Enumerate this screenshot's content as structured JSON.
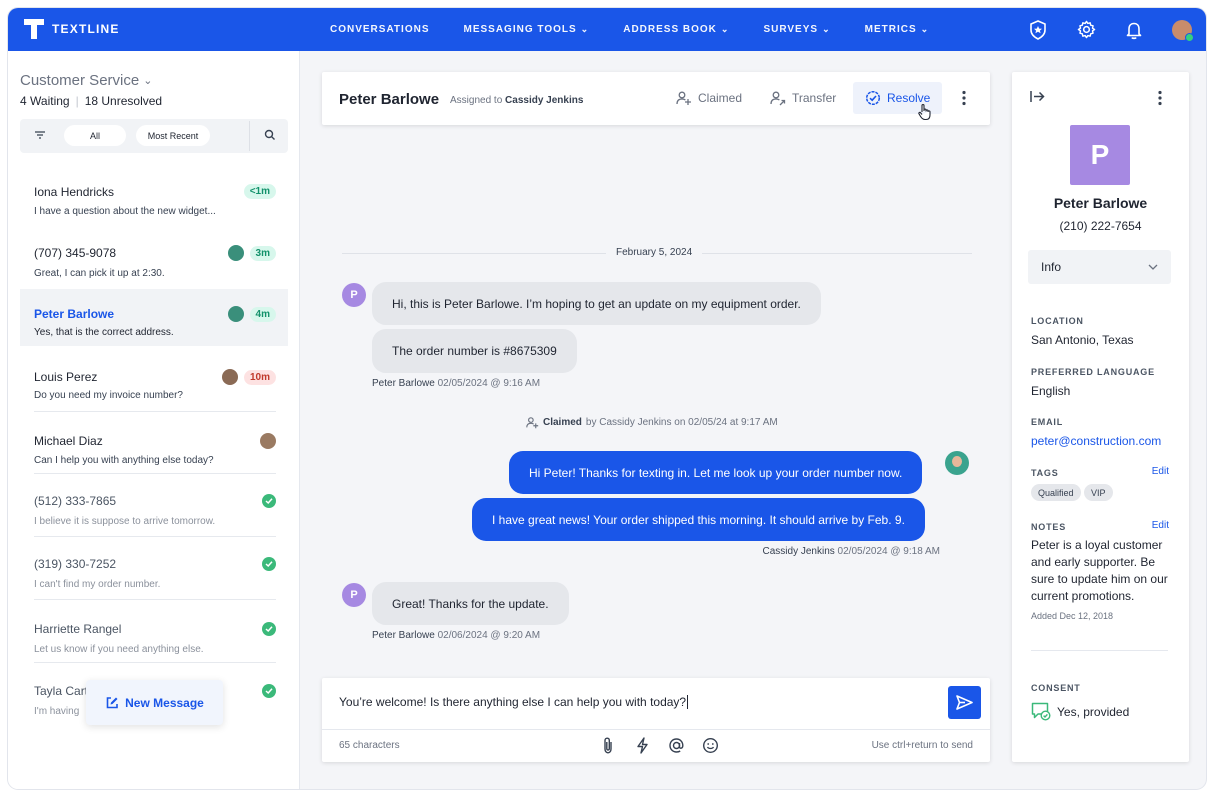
{
  "app": {
    "logo_text": "TEXTLINE",
    "brand_color": "#1a56e8"
  },
  "nav": [
    {
      "label": "CONVERSATIONS",
      "has_menu": false
    },
    {
      "label": "MESSAGING TOOLS",
      "has_menu": true
    },
    {
      "label": "ADDRESS BOOK",
      "has_menu": true
    },
    {
      "label": "SURVEYS",
      "has_menu": true
    },
    {
      "label": "METRICS",
      "has_menu": true
    }
  ],
  "top_icons": [
    "shield-star-icon",
    "gear-icon",
    "bell-icon",
    "user-avatar"
  ],
  "sidebar": {
    "queue_title": "Customer Service",
    "waiting": "4 Waiting",
    "unresolved": "18 Unresolved",
    "filter_all": "All",
    "filter_recent": "Most Recent",
    "conversations": [
      {
        "name": "Iona Hendricks",
        "preview": "I have a question about the new widget...",
        "time": "<1m",
        "status": "waiting"
      },
      {
        "name": "(707) 345-9078",
        "preview": "Great, I can pick it up at 2:30.",
        "time": "3m",
        "status": "waiting"
      },
      {
        "name": "Peter Barlowe",
        "preview": "Yes, that is the correct address.",
        "time": "4m",
        "status": "selected"
      },
      {
        "name": "Louis Perez",
        "preview": "Do you need my invoice number?",
        "time": "10m",
        "status": "waiting"
      },
      {
        "name": "Michael Diaz",
        "preview": "Can I help you with anything else today?",
        "time": "",
        "status": "open"
      },
      {
        "name": "(512) 333-7865",
        "preview": "I believe it is suppose to arrive tomorrow.",
        "time": "",
        "status": "resolved"
      },
      {
        "name": "(319) 330-7252",
        "preview": "I can't find my order number.",
        "time": "",
        "status": "resolved"
      },
      {
        "name": "Harriette Rangel",
        "preview": "Let us know if you need anything else.",
        "time": "",
        "status": "resolved"
      },
      {
        "name": "Tayla Cart",
        "preview": "I'm having",
        "time": "",
        "status": "resolved"
      }
    ],
    "new_message_label": "New Message"
  },
  "conversation": {
    "contact_name": "Peter Barlowe",
    "assigned_prefix": "Assigned to",
    "assigned_to": "Cassidy Jenkins",
    "claimed_label": "Claimed",
    "transfer_label": "Transfer",
    "resolve_label": "Resolve",
    "date_divider": "February 5, 2024",
    "contact_initial": "P",
    "messages": [
      {
        "text": "Hi, this is Peter Barlowe. I’m hoping to get an update on my equipment order."
      },
      {
        "text": "The order number is #8675309"
      },
      {
        "text": "Hi Peter! Thanks for texting in. Let me look up your order number now."
      },
      {
        "text": "I have great news! Your order shipped this morning. It should arrive by Feb. 9."
      },
      {
        "text": "Great! Thanks for the update."
      }
    ],
    "meta1_name": "Peter Barlowe",
    "meta1_time": "02/05/2024 @ 9:16 AM",
    "system_action": "Claimed",
    "system_rest": "by Cassidy Jenkins on 02/05/24 at 9:17 AM",
    "meta2_name": "Cassidy Jenkins",
    "meta2_time": "02/05/2024 @ 9:18 AM",
    "meta3_name": "Peter Barlowe",
    "meta3_time": "02/06/2024 @ 9:20 AM"
  },
  "composer": {
    "text": "You’re welcome! Is there anything else I can help you with today?",
    "char_count": "65 characters",
    "hint": "Use ctrl+return to send",
    "icons": [
      "paperclip-icon",
      "lightning-icon",
      "at-icon",
      "emoji-icon"
    ]
  },
  "contact": {
    "initial": "P",
    "name": "Peter Barlowe",
    "phone": "(210) 222-7654",
    "section": "Info",
    "location_label": "LOCATION",
    "location": "San Antonio, Texas",
    "language_label": "PREFERRED LANGUAGE",
    "language": "English",
    "email_label": "EMAIL",
    "email": "peter@construction.com",
    "tags_label": "TAGS",
    "tags": [
      "Qualified",
      "VIP"
    ],
    "edit_label": "Edit",
    "notes_label": "NOTES",
    "notes": "Peter is a loyal customer and early supporter. Be sure to update him on our current promotions.",
    "notes_date": "Added Dec 12, 2018",
    "consent_label": "CONSENT",
    "consent": "Yes, provided"
  }
}
